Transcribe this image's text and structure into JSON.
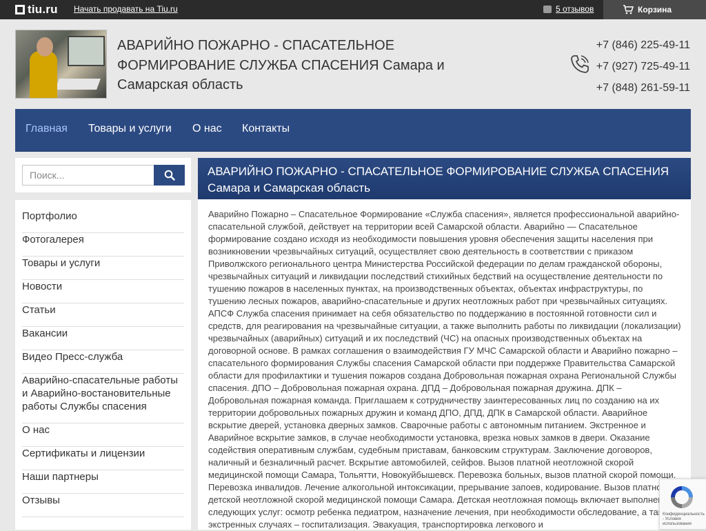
{
  "topbar": {
    "logo_text": "tiu.ru",
    "sell_link": "Начать продавать на Tiu.ru",
    "reviews": "5 отзывов",
    "cart": "Корзина"
  },
  "header": {
    "title": "АВАРИЙНО ПОЖАРНО - СПАСАТЕЛЬНОЕ ФОРМИРОВАНИЕ СЛУЖБА СПАСЕНИЯ Самара и Самарская область",
    "phones": [
      "+7 (846) 225-49-11",
      "+7 (927) 725-49-11",
      "+7 (848) 261-59-11"
    ]
  },
  "nav": {
    "items": [
      "Главная",
      "Товары и услуги",
      "О нас",
      "Контакты"
    ]
  },
  "search": {
    "placeholder": "Поиск..."
  },
  "sidebar": {
    "items": [
      "Портфолио",
      "Фотогалерея",
      "Товары и услуги",
      "Новости",
      "Статьи",
      "Вакансии",
      "Видео Пресс-служба",
      "Аварийно-спасательные работы и Аварийно-востановительные работы Службы спасения",
      "О нас",
      "Сертификаты и лицензии",
      "Наши партнеры",
      "Отзывы"
    ]
  },
  "main": {
    "heading": "АВАРИЙНО ПОЖАРНО - СПАСАТЕЛЬНОЕ ФОРМИРОВАНИЕ СЛУЖБА СПАСЕНИЯ Самара и Самарская область",
    "body": "Аварийно Пожарно – Спасательное Формирование «Служба спасения», является профессиональной аварийно-спасательной службой, действует на территории всей Самарской области. Аварийно — Спасательное формирование создано исходя из необходимости повышения уровня обеспечения защиты населения при возникновении чрезвычайных ситуаций, осуществляет свою деятельность в соответствии с приказом Приволжского регионального центра Министерства Российской федерации по делам гражданской обороны, чрезвычайных ситуаций и ликвидации последствий стихийных бедствий на осуществление деятельности по тушению пожаров в населенных пунктах, на производственных объектах, объектах инфраструктуры, по тушению лесных пожаров, аварийно-спасательные и других неотложных работ при чрезвычайных ситуациях. АПСФ Служба спасения принимает на себя обязательство по поддержанию в постоянной готовности сил и средств, для реагирования на чрезвычайные ситуации, а также выполнить работы по ликвидации (локализации) чрезвычайных (аварийных) ситуаций и их последствий (ЧС) на опасных производственных объектах на договорной основе. В рамках соглашения о взаимодействия ГУ МЧС Самарской области и Аварийно пожарно – спасательного формирования Службы спасения Самарской области при поддержке Правительства Самарской области для профилактики и тушения пожаров создана Добровольная пожарная охрана Региональной Службы спасения. ДПО – Добровольная пожарная охрана. ДПД – Добровольная пожарная дружина. ДПК – Добровольная пожарная команда. Приглашаем к сотрудничеству заинтересованных лиц по созданию на их территории добровольных пожарных дружин и команд ДПО, ДПД, ДПК в Самарской области. Аварийное вскрытие дверей, установка дверных замков. Сварочные работы с автономным питанием. Экстренное и Аварийное вскрытие замков, в случае необходимости установка, врезка новых замков в двери. Оказание содействия оперативным службам, судебным приставам, банковским структурам. Заключение договоров, наличный и безналичный расчет. Вскрытие автомобилей, сейфов. Вызов платной неотложной скорой медицинской помощи Самара, Тольятти, Новокуйбышевск. Перевозка больных, вызов платной скорой помощи. Перевозка инвалидов. Лечение алкогольной интоксикации, прерывание запоев, кодирование. Вызов платной детской неотложной скорой медицинской помощи Самара. Детская неотложная помощь включает выполнение следующих услуг: осмотр ребенка педиатром, назначение лечения, при необходимости обследование, а также в экстренных случаях – госпитализация. Эвакуация, транспортировка легкового и"
  },
  "recaptcha": {
    "text": "Конфиденциальность - Условия использования"
  },
  "colors": {
    "topbar": "#2b2b2b",
    "nav": "#2c4a82",
    "nav_active": "#a9c4ff",
    "background": "#e8e8e8"
  }
}
